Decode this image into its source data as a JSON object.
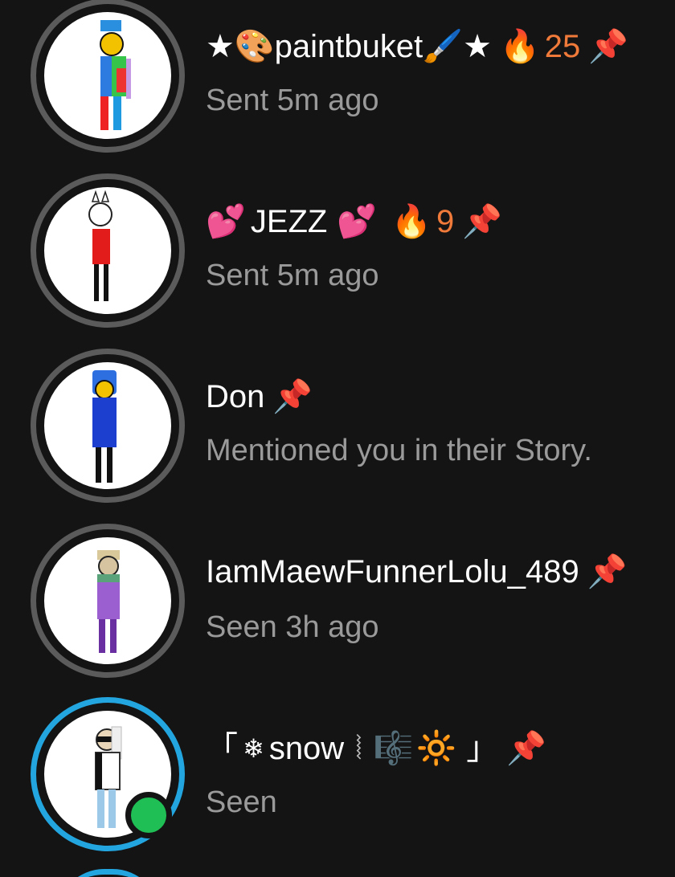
{
  "chats": [
    {
      "name_prefix": "★",
      "name": "paintbuket",
      "name_suffix": "★",
      "streak": "25",
      "status": "Sent 5m ago",
      "avatar_icon": "avatar-rainbow-character-icon",
      "pin_icon": "pin-icon",
      "colors": {
        "accent": "#f07a3a"
      }
    },
    {
      "name": "JEZZ",
      "streak": "9",
      "status": "Sent 5m ago",
      "avatar_icon": "avatar-red-shirt-character-icon",
      "pin_icon": "pin-icon"
    },
    {
      "name": "Don",
      "status": "Mentioned you in their Story.",
      "avatar_icon": "avatar-blue-hood-character-icon",
      "pin_icon": "pin-icon"
    },
    {
      "name": "IamMaewFunnerLolu_489",
      "status": "Seen 3h ago",
      "avatar_icon": "avatar-purple-character-icon",
      "pin_icon": "pin-icon"
    },
    {
      "name_open": "「",
      "name": "snow",
      "name_close": "」",
      "status": "Seen",
      "avatar_icon": "avatar-sunglasses-character-icon",
      "pin_icon": "pin-icon",
      "online": true
    }
  ],
  "colors": {
    "background": "#141414",
    "status_text": "#9a9a9a",
    "ring_default": "#5b5b5b",
    "ring_story": "#23a6e0",
    "online": "#1fbf55",
    "streak": "#f07a3a"
  }
}
